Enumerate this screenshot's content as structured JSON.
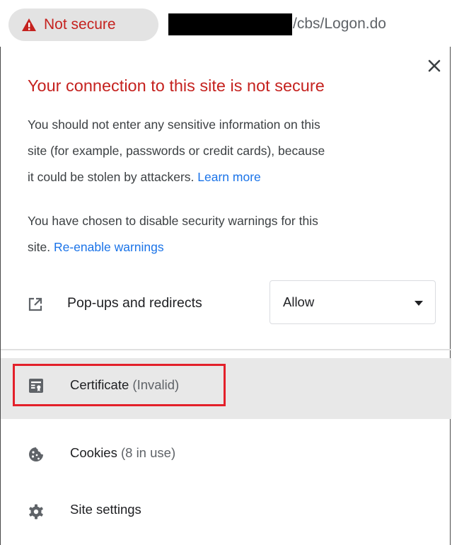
{
  "omnibox": {
    "security_chip_label": "Not secure",
    "url_suffix": "/cbs/Logon.do"
  },
  "popup": {
    "title": "Your connection to this site is not secure",
    "paragraph1_lines": [
      "You should not enter any sensitive information on this",
      "site (for example, passwords or credit cards), because",
      "it could be stolen by attackers. "
    ],
    "learn_more_link": "Learn more",
    "paragraph2_lines": [
      "You have chosen to disable security warnings for this",
      "site. "
    ],
    "reenable_link": "Re-enable warnings",
    "popups_label": "Pop-ups and redirects",
    "popups_select_value": "Allow",
    "certificate_label": "Certificate",
    "certificate_status": "(Invalid)",
    "cookies_label": "Cookies",
    "cookies_status": "(8 in use)",
    "site_settings_label": "Site settings"
  },
  "icons": {
    "warning": "warning-triangle-icon",
    "close": "close-icon",
    "popups": "open-in-new-icon",
    "certificate": "certificate-icon",
    "cookies": "cookie-icon",
    "site_settings": "gear-icon"
  },
  "colors": {
    "danger": "#c5221f",
    "link": "#1a73e8",
    "highlight_box": "#e3202a",
    "selected_row": "#e8e8e8",
    "chip_bg": "#e3e3e3"
  }
}
